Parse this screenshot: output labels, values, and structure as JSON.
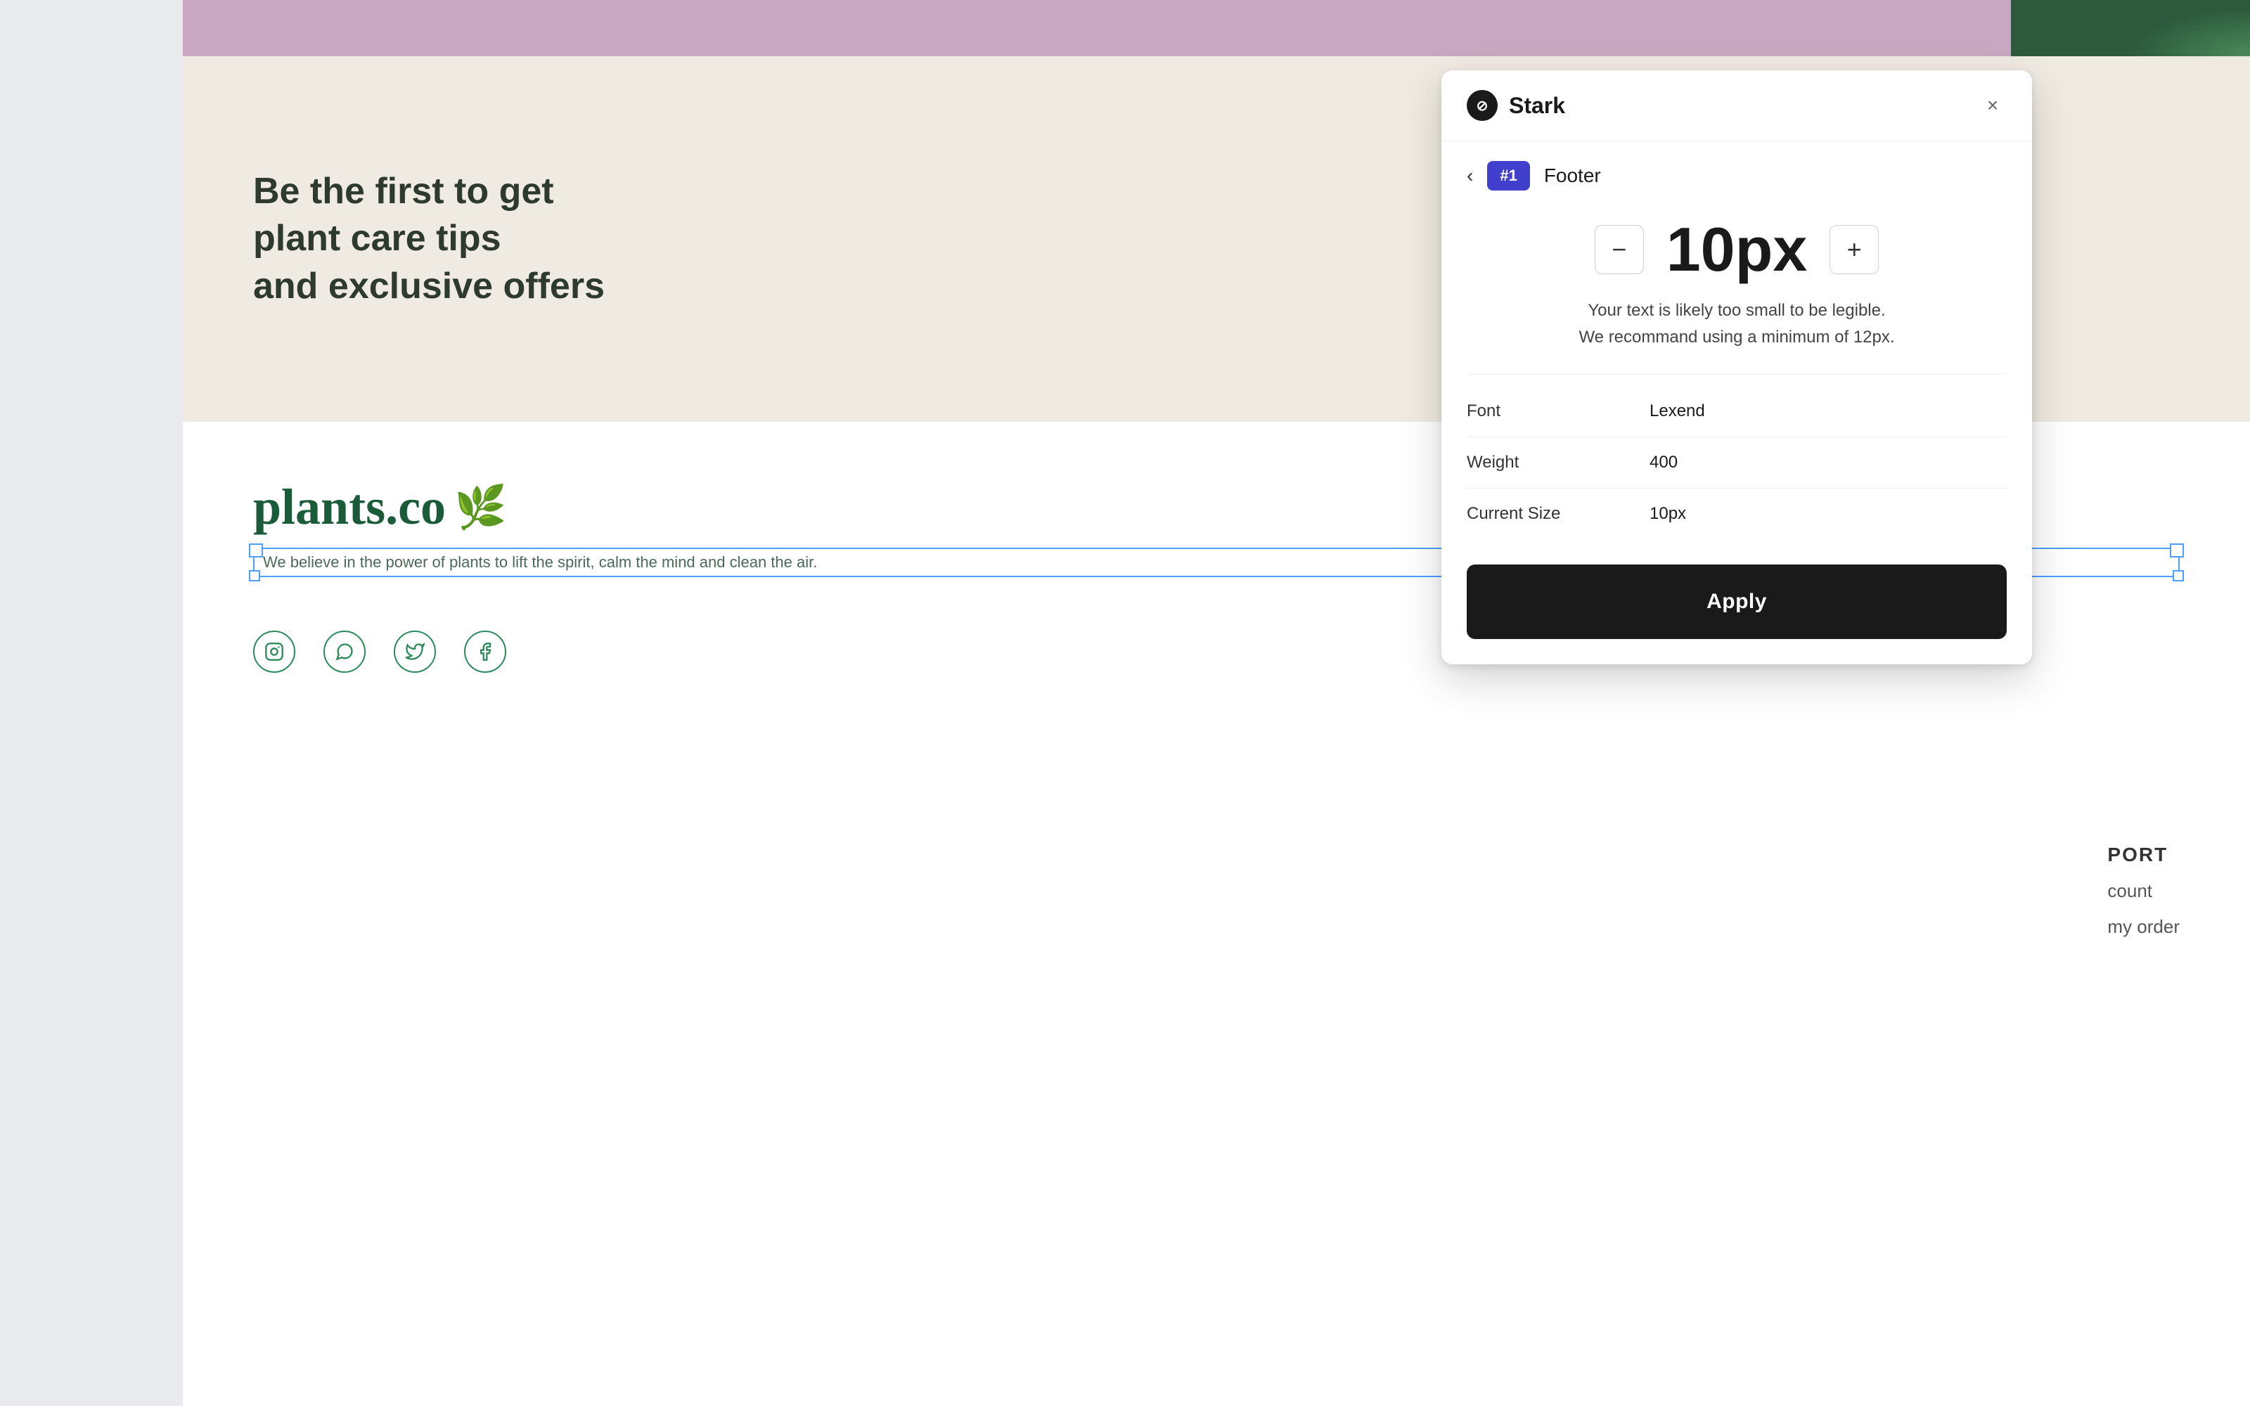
{
  "website": {
    "banner": {
      "bg_color": "#c8a8c0",
      "plant_color": "#2d5a3d"
    },
    "hero": {
      "text": "Be the first to get plant care tips\nand exclusive offers",
      "bg_color": "#f0ebe2"
    },
    "footer": {
      "logo_text": "plants.co",
      "logo_leaf": "🌿",
      "tagline": "We believe in the power of plants to lift the spirit, calm the mind and clean the air.",
      "social_icons": [
        "instagram",
        "whatsapp",
        "twitter",
        "facebook"
      ]
    },
    "right_sidebar": {
      "header": "PORT",
      "links": [
        "count",
        "my order"
      ]
    }
  },
  "stark_panel": {
    "logo_symbol": "⊘",
    "title": "Stark",
    "close_label": "×",
    "back_label": "‹",
    "issue_badge": "#1",
    "section_name": "Footer",
    "size": {
      "value": "10px",
      "decrement": "−",
      "increment": "+"
    },
    "warning": {
      "line1": "Your text is likely too small to be legible.",
      "line2": "We recommand using a minimum of 12px."
    },
    "properties": [
      {
        "label": "Font",
        "value": "Lexend"
      },
      {
        "label": "Weight",
        "value": "400"
      },
      {
        "label": "Current Size",
        "value": "10px"
      }
    ],
    "apply_button": "Apply"
  }
}
